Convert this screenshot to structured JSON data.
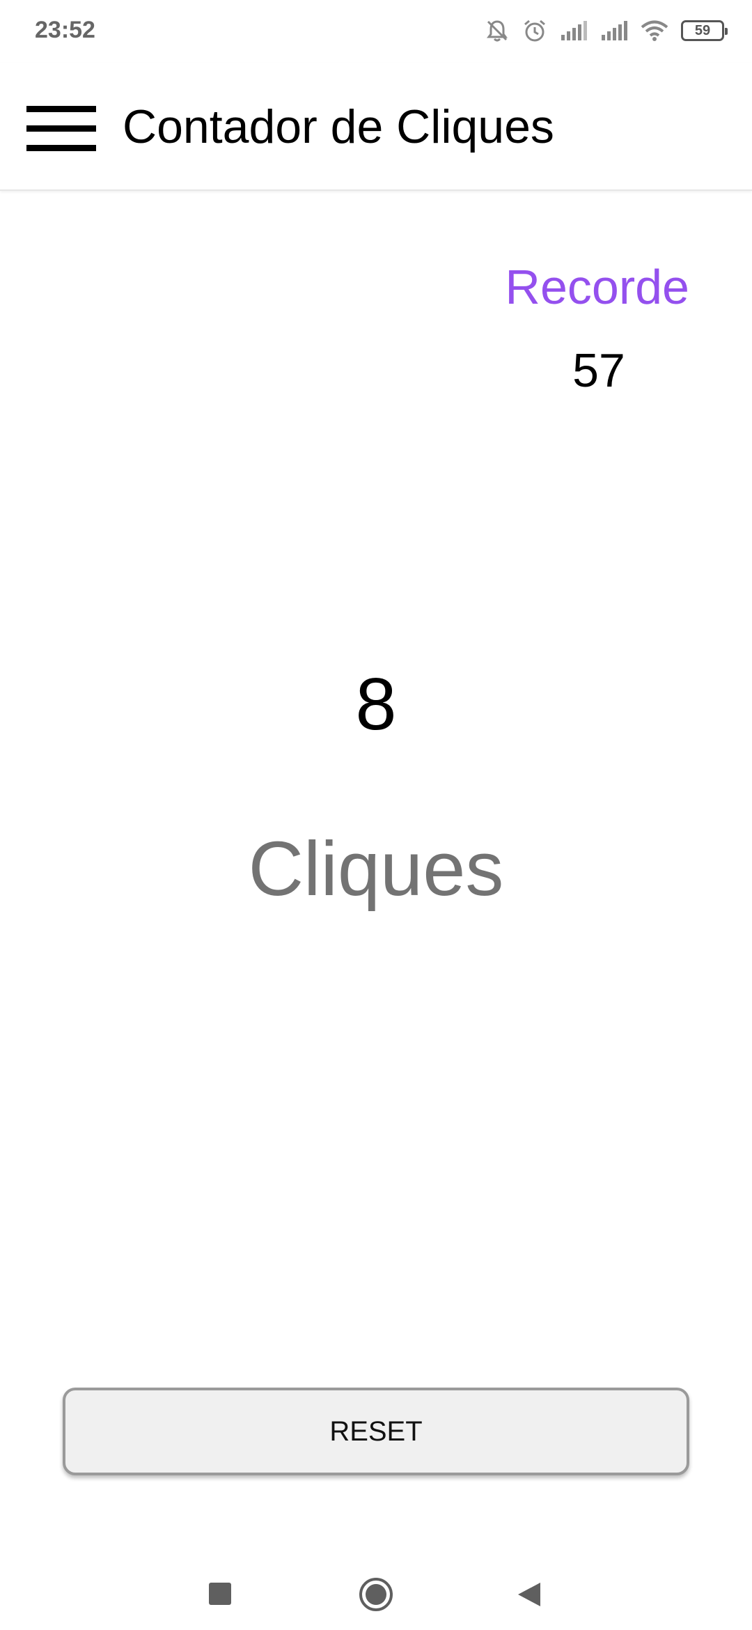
{
  "status_bar": {
    "time": "23:52",
    "battery": "59",
    "icons": [
      "notifications-off-icon",
      "alarm-icon",
      "signal-icon",
      "signal-icon",
      "wifi-icon",
      "battery-icon"
    ]
  },
  "app_bar": {
    "title": "Contador de Cliques",
    "menu_icon": "hamburger-menu-icon"
  },
  "record": {
    "label": "Recorde",
    "value": "57",
    "label_color": "#9450ee"
  },
  "counter": {
    "value": "8",
    "label": "Cliques",
    "label_color": "#737373"
  },
  "reset_button": {
    "label": "RESET"
  },
  "nav_bar": {
    "icons": [
      "recents-square-icon",
      "home-circle-icon",
      "back-triangle-icon"
    ]
  }
}
